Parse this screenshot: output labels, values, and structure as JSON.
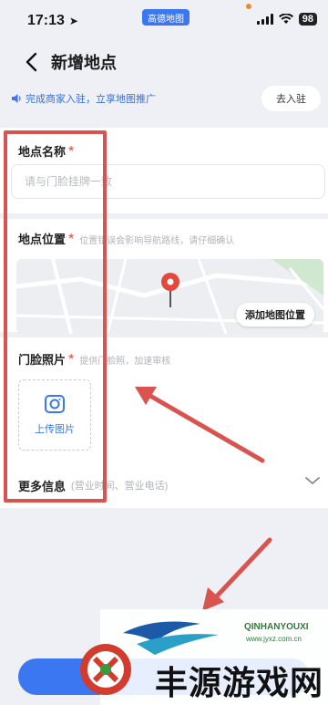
{
  "status": {
    "time": "17:13",
    "app_pill": "高德地图",
    "battery": "98"
  },
  "nav": {
    "title": "新增地点"
  },
  "banner": {
    "text": "完成商家入驻，立享地图推广",
    "button": "去入驻"
  },
  "name_field": {
    "label": "地点名称",
    "required_mark": "*",
    "placeholder": "请与门脸挂牌一致"
  },
  "location_field": {
    "label": "地点位置",
    "required_mark": "*",
    "hint": "位置错误会影响导航路线，请仔细确认",
    "map_button": "添加地图位置"
  },
  "photo_field": {
    "label": "门脸照片",
    "required_mark": "*",
    "hint": "提供门脸照，加速审核",
    "upload_label": "上传图片"
  },
  "more_info": {
    "label": "更多信息",
    "hint": "(营业时间、营业电话)"
  },
  "watermark": {
    "big_text": "丰源游戏网",
    "brand": "QINHANYOUXI",
    "site": "www.jyxz.com.cn"
  },
  "colors": {
    "accent": "#3a77f0",
    "required": "#e2483d",
    "annotation": "#d9534f"
  }
}
